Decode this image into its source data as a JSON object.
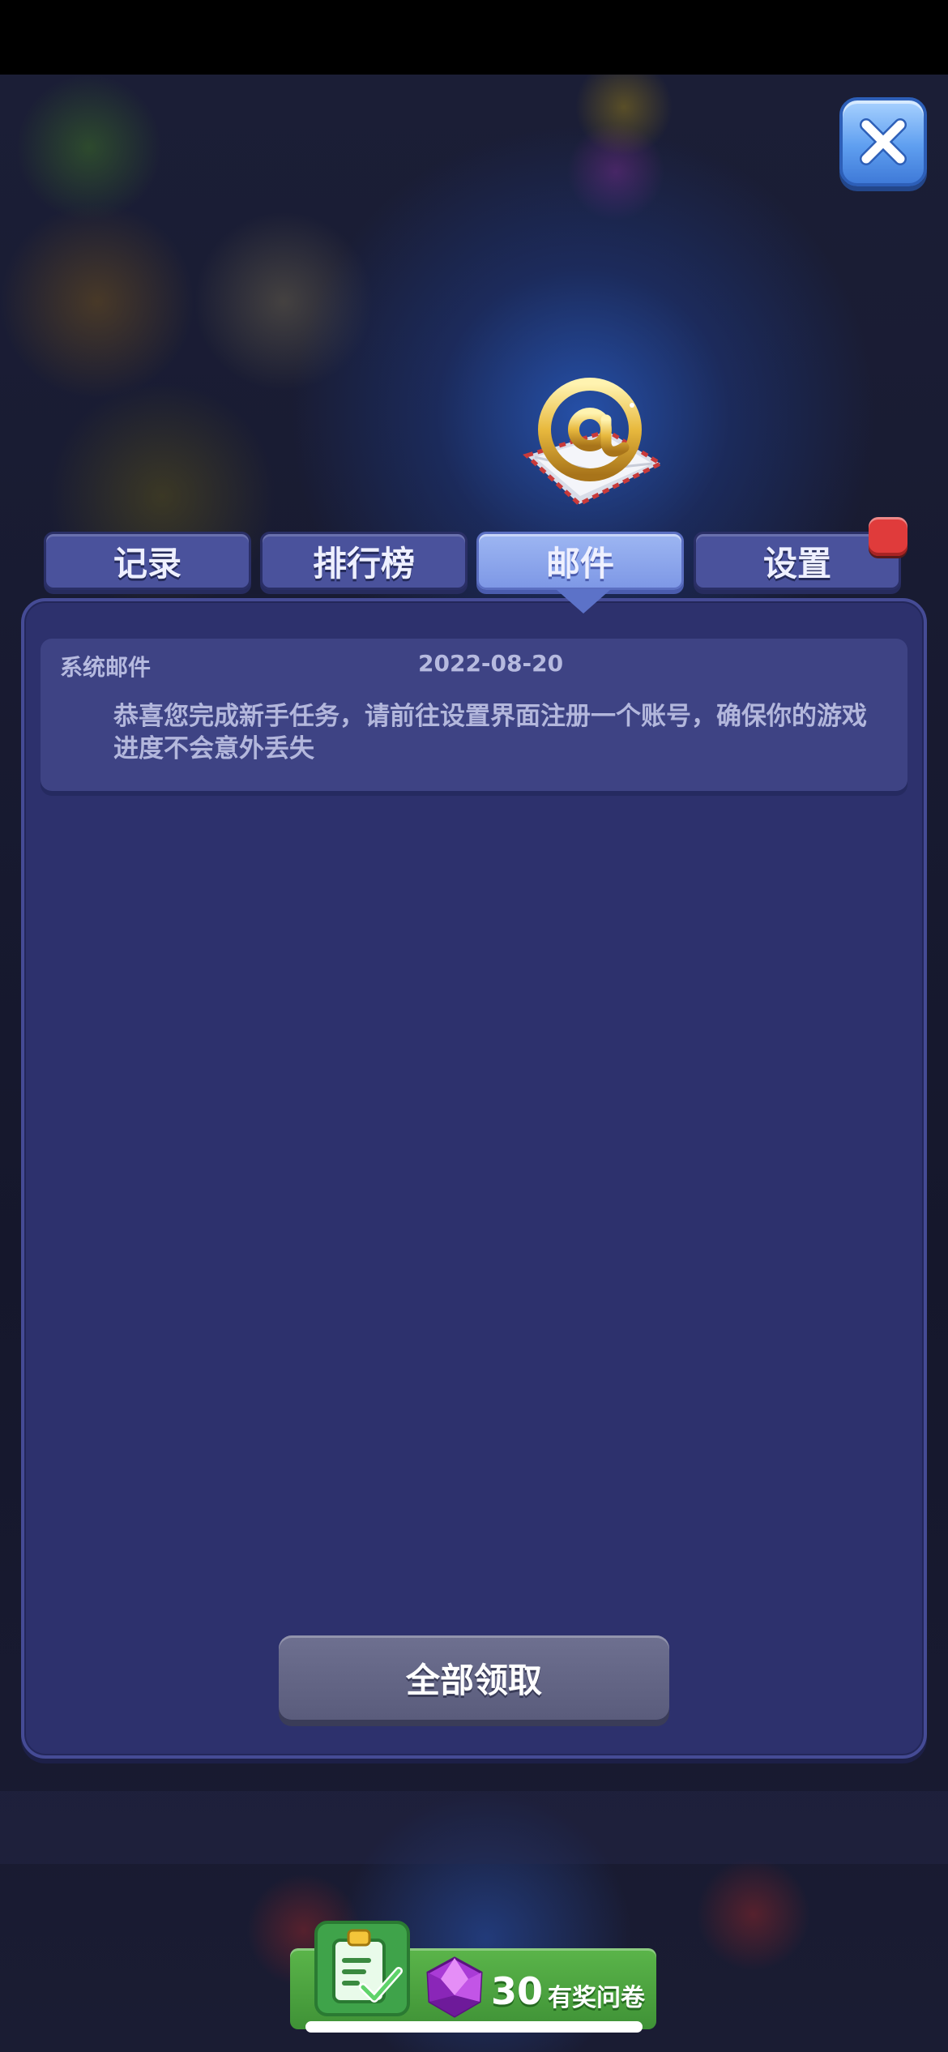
{
  "tabs": [
    {
      "label": "记录",
      "active": false
    },
    {
      "label": "排行榜",
      "active": false
    },
    {
      "label": "邮件",
      "active": true
    },
    {
      "label": "设置",
      "active": false,
      "has_notification": true
    }
  ],
  "mail": {
    "items": [
      {
        "sender": "系统邮件",
        "date": "2022-08-20",
        "body": "恭喜您完成新手任务，请前往设置界面注册一个账号，确保你的游戏进度不会意外丢失"
      }
    ],
    "claim_all_label": "全部领取"
  },
  "survey": {
    "reward_amount": "30",
    "label": "有奖问卷",
    "reward_icon": "purple-gem-icon"
  },
  "icons": {
    "close": "close-icon",
    "mail": "at-sign-mail-icon",
    "survey": "clipboard-check-icon"
  },
  "colors": {
    "panel": "#2d316d",
    "tab": "#4a529c",
    "tab_active": "#8aa4ec",
    "notification": "#e03b3b",
    "survey_green": "#4ea542"
  }
}
